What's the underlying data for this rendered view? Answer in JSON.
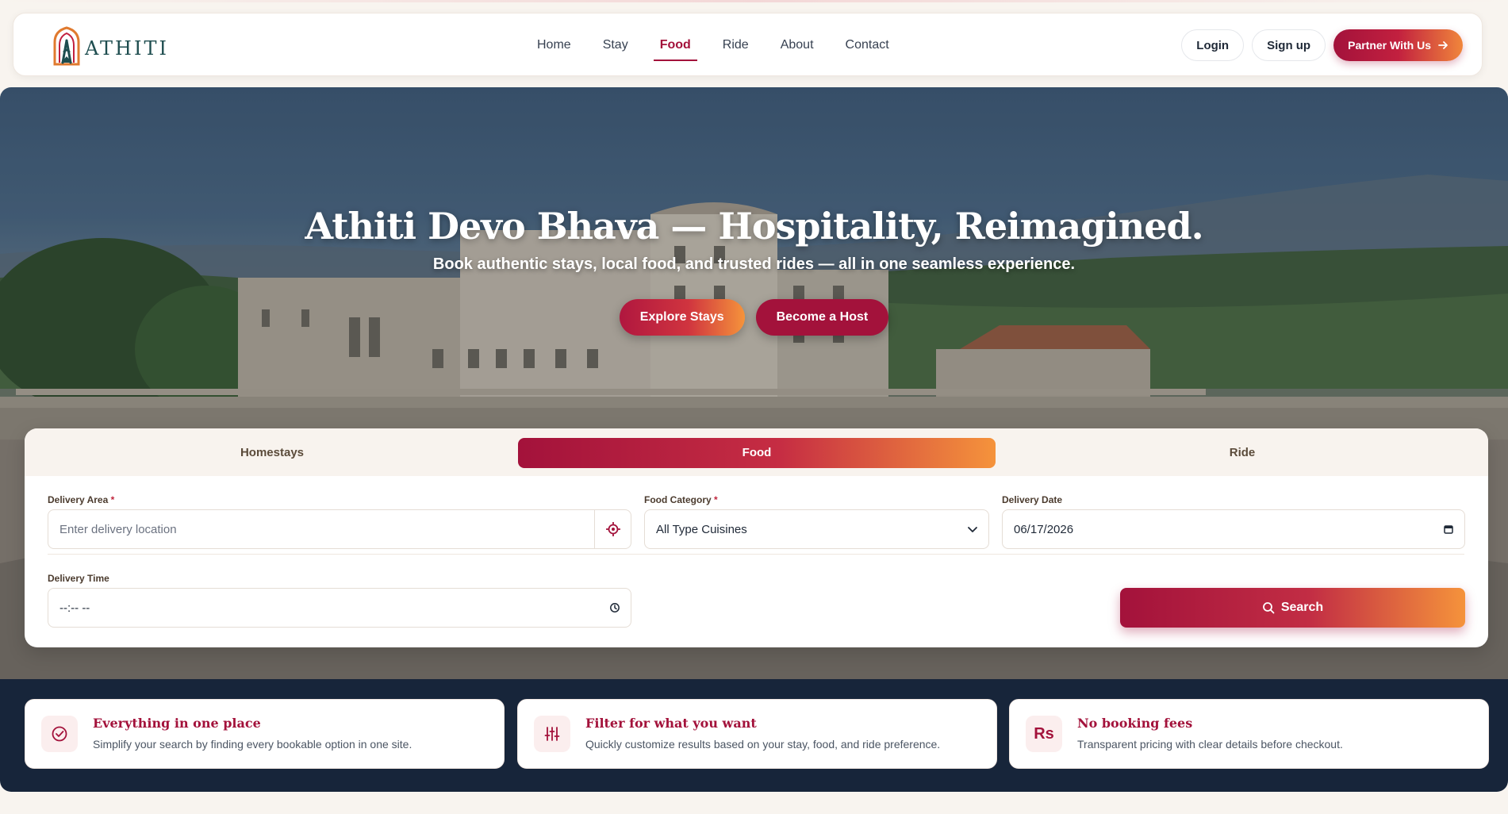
{
  "brand": {
    "name": "ATHITI"
  },
  "nav": {
    "links": [
      {
        "label": "Home"
      },
      {
        "label": "Stay"
      },
      {
        "label": "Food"
      },
      {
        "label": "Ride"
      },
      {
        "label": "About"
      },
      {
        "label": "Contact"
      }
    ],
    "active": "Food",
    "login_label": "Login",
    "signup_label": "Sign up",
    "partner_label": "Partner With Us"
  },
  "hero": {
    "title": "Athiti Devo Bhava — Hospitality, Reimagined.",
    "subtitle": "Book authentic stays, local food, and trusted rides — all in one seamless experience.",
    "cta_primary": "Explore Stays",
    "cta_secondary": "Become a Host"
  },
  "search": {
    "tabs": [
      {
        "label": "Homestays"
      },
      {
        "label": "Food"
      },
      {
        "label": "Ride"
      }
    ],
    "active_tab": "Food",
    "delivery_area": {
      "label": "Delivery Area",
      "required": "*",
      "placeholder": "Enter delivery location",
      "value": ""
    },
    "food_category": {
      "label": "Food Category",
      "required": "*",
      "value": "All Type Cuisines"
    },
    "delivery_date": {
      "label": "Delivery Date",
      "value": "06/17/2026"
    },
    "delivery_time": {
      "label": "Delivery Time",
      "value": "--:-- --"
    },
    "search_label": "Search"
  },
  "features": [
    {
      "title": "Everything in one place",
      "desc": "Simplify your search by finding every bookable option in one site.",
      "icon": "check-circle-icon"
    },
    {
      "title": "Filter for what you want",
      "desc": "Quickly customize results based on your stay, food, and ride preference.",
      "icon": "sliders-icon"
    },
    {
      "title": "No booking fees",
      "desc": "Transparent pricing with clear details before checkout.",
      "icon": "rupee-icon",
      "icon_text": "Rs"
    }
  ],
  "colors": {
    "brand_primary": "#a3123b",
    "brand_accent": "#f5933b",
    "dark_navy": "#17253a",
    "logo_teal": "#1e4d4f"
  }
}
